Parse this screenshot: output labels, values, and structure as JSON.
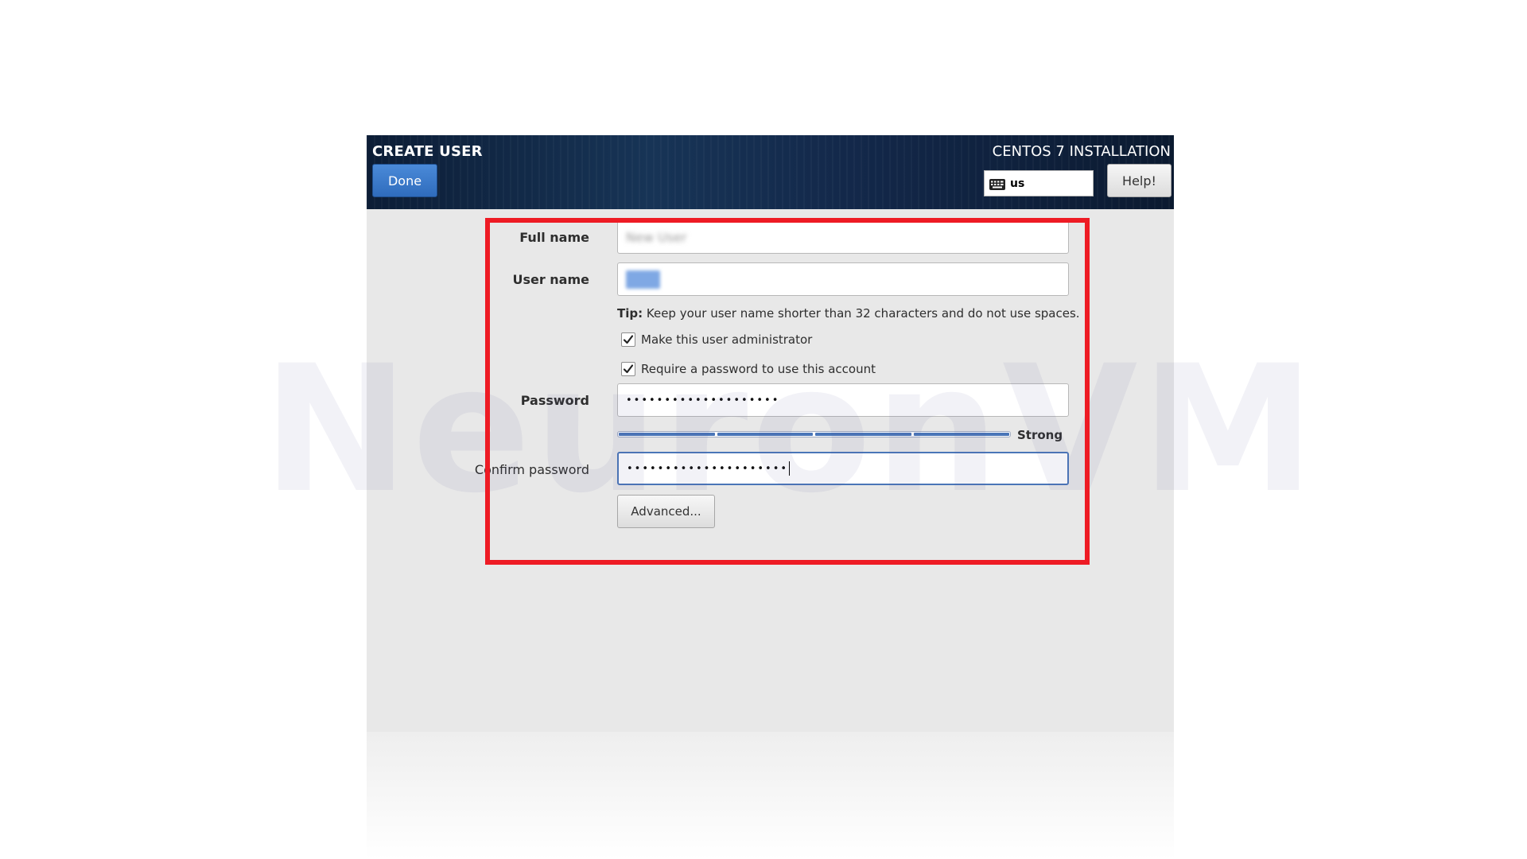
{
  "header": {
    "spoke_title": "CREATE USER",
    "done_label": "Done",
    "product_title": "CENTOS 7 INSTALLATION",
    "keyboard_layout": "us",
    "help_label": "Help!"
  },
  "form": {
    "full_name": {
      "label": "Full name",
      "value": "New User"
    },
    "user_name": {
      "label": "User name",
      "value": "user"
    },
    "tip": {
      "prefix": "Tip:",
      "text": "Keep your user name shorter than 32 characters and do not use spaces."
    },
    "make_admin": {
      "label": "Make this user administrator",
      "checked": true
    },
    "require_password": {
      "label": "Require a password to use this account",
      "checked": true
    },
    "password": {
      "label": "Password",
      "masked_value": "••••••••••••••••••••"
    },
    "strength": {
      "label": "Strong",
      "level": 1.0,
      "segments": 4
    },
    "confirm_password": {
      "label": "Confirm password",
      "masked_value": "•••••••••••••••••••••"
    },
    "advanced_label": "Advanced..."
  },
  "watermark": "NeuronVM",
  "colors": {
    "accent": "#2f6cbd",
    "highlight": "#ee1b24",
    "header_bg": "#13284a",
    "panel_bg": "#e8e8e8"
  }
}
